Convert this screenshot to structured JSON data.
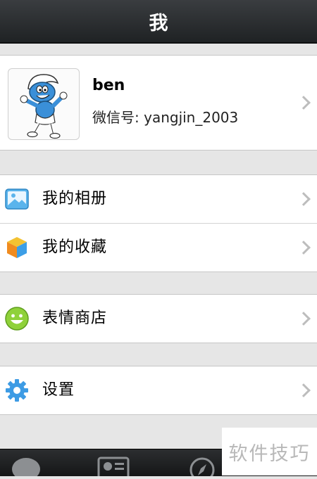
{
  "header": {
    "title": "我"
  },
  "profile": {
    "name": "ben",
    "wechat_label": "微信号:",
    "wechat_id": "yangjin_2003"
  },
  "menu": {
    "album": "我的相册",
    "favorites": "我的收藏",
    "sticker_store": "表情商店",
    "settings": "设置"
  },
  "tabbar": {
    "icons": [
      "chat-bubble-icon",
      "contacts-card-icon",
      "compass-icon"
    ]
  },
  "watermark": {
    "text": "软件技巧"
  }
}
